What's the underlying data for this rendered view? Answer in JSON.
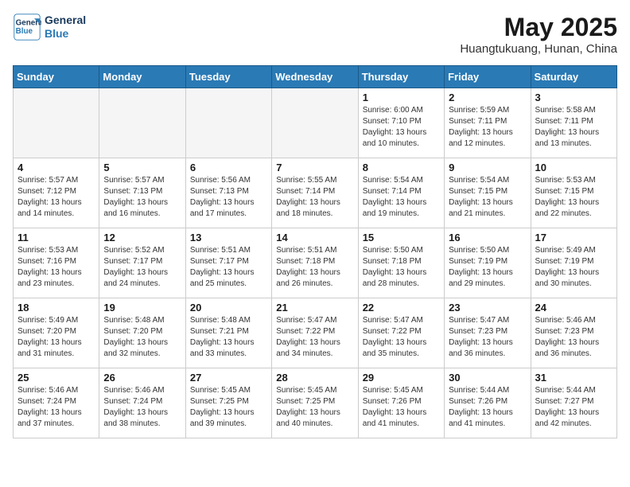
{
  "logo": {
    "line1": "General",
    "line2": "Blue"
  },
  "header": {
    "month": "May 2025",
    "location": "Huangtukuang, Hunan, China"
  },
  "weekdays": [
    "Sunday",
    "Monday",
    "Tuesday",
    "Wednesday",
    "Thursday",
    "Friday",
    "Saturday"
  ],
  "weeks": [
    [
      {
        "day": "",
        "info": ""
      },
      {
        "day": "",
        "info": ""
      },
      {
        "day": "",
        "info": ""
      },
      {
        "day": "",
        "info": ""
      },
      {
        "day": "1",
        "info": "Sunrise: 6:00 AM\nSunset: 7:10 PM\nDaylight: 13 hours\nand 10 minutes."
      },
      {
        "day": "2",
        "info": "Sunrise: 5:59 AM\nSunset: 7:11 PM\nDaylight: 13 hours\nand 12 minutes."
      },
      {
        "day": "3",
        "info": "Sunrise: 5:58 AM\nSunset: 7:11 PM\nDaylight: 13 hours\nand 13 minutes."
      }
    ],
    [
      {
        "day": "4",
        "info": "Sunrise: 5:57 AM\nSunset: 7:12 PM\nDaylight: 13 hours\nand 14 minutes."
      },
      {
        "day": "5",
        "info": "Sunrise: 5:57 AM\nSunset: 7:13 PM\nDaylight: 13 hours\nand 16 minutes."
      },
      {
        "day": "6",
        "info": "Sunrise: 5:56 AM\nSunset: 7:13 PM\nDaylight: 13 hours\nand 17 minutes."
      },
      {
        "day": "7",
        "info": "Sunrise: 5:55 AM\nSunset: 7:14 PM\nDaylight: 13 hours\nand 18 minutes."
      },
      {
        "day": "8",
        "info": "Sunrise: 5:54 AM\nSunset: 7:14 PM\nDaylight: 13 hours\nand 19 minutes."
      },
      {
        "day": "9",
        "info": "Sunrise: 5:54 AM\nSunset: 7:15 PM\nDaylight: 13 hours\nand 21 minutes."
      },
      {
        "day": "10",
        "info": "Sunrise: 5:53 AM\nSunset: 7:15 PM\nDaylight: 13 hours\nand 22 minutes."
      }
    ],
    [
      {
        "day": "11",
        "info": "Sunrise: 5:53 AM\nSunset: 7:16 PM\nDaylight: 13 hours\nand 23 minutes."
      },
      {
        "day": "12",
        "info": "Sunrise: 5:52 AM\nSunset: 7:17 PM\nDaylight: 13 hours\nand 24 minutes."
      },
      {
        "day": "13",
        "info": "Sunrise: 5:51 AM\nSunset: 7:17 PM\nDaylight: 13 hours\nand 25 minutes."
      },
      {
        "day": "14",
        "info": "Sunrise: 5:51 AM\nSunset: 7:18 PM\nDaylight: 13 hours\nand 26 minutes."
      },
      {
        "day": "15",
        "info": "Sunrise: 5:50 AM\nSunset: 7:18 PM\nDaylight: 13 hours\nand 28 minutes."
      },
      {
        "day": "16",
        "info": "Sunrise: 5:50 AM\nSunset: 7:19 PM\nDaylight: 13 hours\nand 29 minutes."
      },
      {
        "day": "17",
        "info": "Sunrise: 5:49 AM\nSunset: 7:19 PM\nDaylight: 13 hours\nand 30 minutes."
      }
    ],
    [
      {
        "day": "18",
        "info": "Sunrise: 5:49 AM\nSunset: 7:20 PM\nDaylight: 13 hours\nand 31 minutes."
      },
      {
        "day": "19",
        "info": "Sunrise: 5:48 AM\nSunset: 7:20 PM\nDaylight: 13 hours\nand 32 minutes."
      },
      {
        "day": "20",
        "info": "Sunrise: 5:48 AM\nSunset: 7:21 PM\nDaylight: 13 hours\nand 33 minutes."
      },
      {
        "day": "21",
        "info": "Sunrise: 5:47 AM\nSunset: 7:22 PM\nDaylight: 13 hours\nand 34 minutes."
      },
      {
        "day": "22",
        "info": "Sunrise: 5:47 AM\nSunset: 7:22 PM\nDaylight: 13 hours\nand 35 minutes."
      },
      {
        "day": "23",
        "info": "Sunrise: 5:47 AM\nSunset: 7:23 PM\nDaylight: 13 hours\nand 36 minutes."
      },
      {
        "day": "24",
        "info": "Sunrise: 5:46 AM\nSunset: 7:23 PM\nDaylight: 13 hours\nand 36 minutes."
      }
    ],
    [
      {
        "day": "25",
        "info": "Sunrise: 5:46 AM\nSunset: 7:24 PM\nDaylight: 13 hours\nand 37 minutes."
      },
      {
        "day": "26",
        "info": "Sunrise: 5:46 AM\nSunset: 7:24 PM\nDaylight: 13 hours\nand 38 minutes."
      },
      {
        "day": "27",
        "info": "Sunrise: 5:45 AM\nSunset: 7:25 PM\nDaylight: 13 hours\nand 39 minutes."
      },
      {
        "day": "28",
        "info": "Sunrise: 5:45 AM\nSunset: 7:25 PM\nDaylight: 13 hours\nand 40 minutes."
      },
      {
        "day": "29",
        "info": "Sunrise: 5:45 AM\nSunset: 7:26 PM\nDaylight: 13 hours\nand 41 minutes."
      },
      {
        "day": "30",
        "info": "Sunrise: 5:44 AM\nSunset: 7:26 PM\nDaylight: 13 hours\nand 41 minutes."
      },
      {
        "day": "31",
        "info": "Sunrise: 5:44 AM\nSunset: 7:27 PM\nDaylight: 13 hours\nand 42 minutes."
      }
    ]
  ]
}
